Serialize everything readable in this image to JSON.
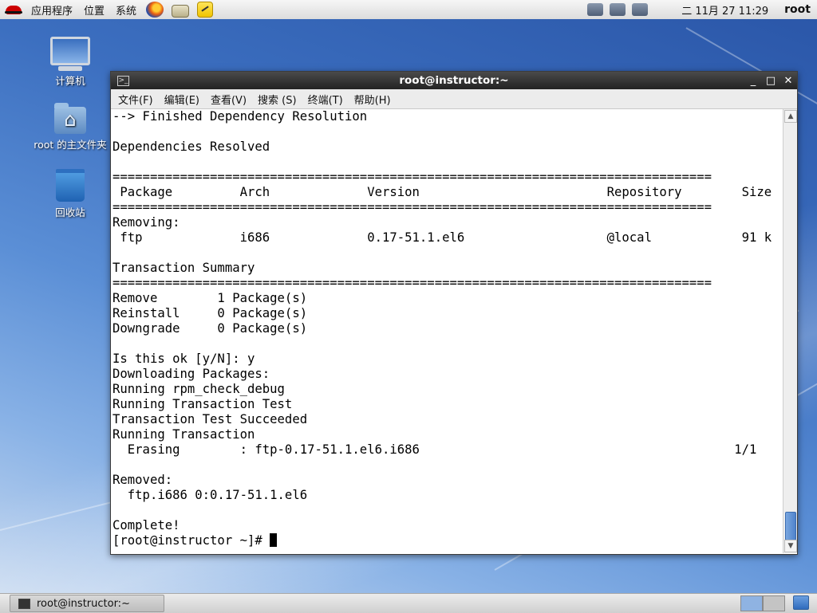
{
  "top_panel": {
    "menus": [
      "应用程序",
      "位置",
      "系统"
    ],
    "clock": "二 11月 27 11:29",
    "user": "root"
  },
  "desktop_icons": [
    {
      "label": "计算机"
    },
    {
      "label": "root 的主文件夹"
    },
    {
      "label": "回收站"
    }
  ],
  "window": {
    "title": "root@instructor:~",
    "buttons": {
      "minimize": "_",
      "maximize": "□",
      "close": "✕"
    },
    "menu": [
      "文件(F)",
      "编辑(E)",
      "查看(V)",
      "搜索 (S)",
      "终端(T)",
      "帮助(H)"
    ]
  },
  "terminal": {
    "lines": [
      "--> Finished Dependency Resolution",
      "",
      "Dependencies Resolved",
      "",
      "================================================================================",
      " Package         Arch             Version                         Repository        Size",
      "================================================================================",
      "Removing:",
      " ftp             i686             0.17-51.1.el6                   @local            91 k",
      "",
      "Transaction Summary",
      "================================================================================",
      "Remove        1 Package(s)",
      "Reinstall     0 Package(s)",
      "Downgrade     0 Package(s)",
      "",
      "Is this ok [y/N]: y",
      "Downloading Packages:",
      "Running rpm_check_debug",
      "Running Transaction Test",
      "Transaction Test Succeeded",
      "Running Transaction",
      "  Erasing        : ftp-0.17-51.1.el6.i686                                          1/1",
      "",
      "Removed:",
      "  ftp.i686 0:0.17-51.1.el6",
      "",
      "Complete!"
    ],
    "prompt": "[root@instructor ~]# "
  },
  "bottom_panel": {
    "task_label": "root@instructor:~"
  }
}
